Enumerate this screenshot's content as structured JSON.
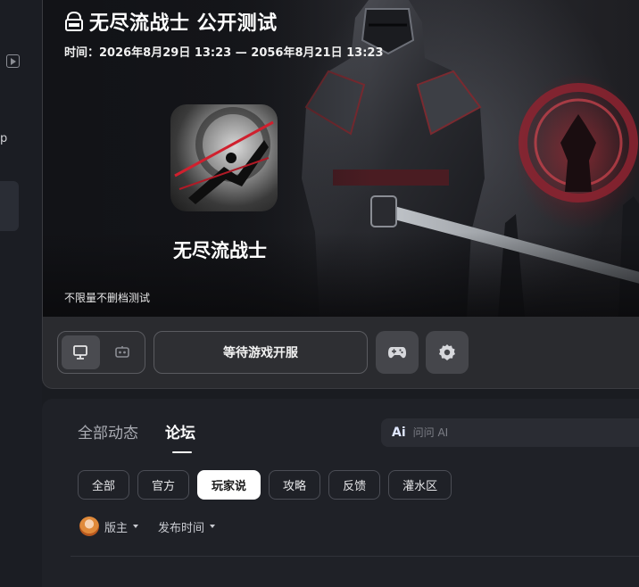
{
  "sidebar": {
    "item_text_partial": "p"
  },
  "hero": {
    "title": "无尽流战士 公开测试",
    "time": "时间：2026年8月29日 13:23 — 2056年8月21日 13:23",
    "game_name": "无尽流战士",
    "subtitle": "不限量不删档测试",
    "wait_button": "等待游戏开服",
    "platforms": [
      {
        "name": "pc",
        "icon": "monitor-icon",
        "active": true
      },
      {
        "name": "cloud",
        "icon": "cloud-gaming-icon",
        "active": false
      }
    ],
    "extra_buttons": [
      {
        "icon": "gamepad-icon"
      },
      {
        "icon": "settings-icon"
      }
    ]
  },
  "forum": {
    "tabs": [
      {
        "label": "全部动态",
        "active": false
      },
      {
        "label": "论坛",
        "active": true
      }
    ],
    "ask_ai": {
      "icon_text": "Ai",
      "placeholder": "问问 AI"
    },
    "categories": [
      {
        "label": "全部",
        "active": false
      },
      {
        "label": "官方",
        "active": false
      },
      {
        "label": "玩家说",
        "active": true
      },
      {
        "label": "攻略",
        "active": false
      },
      {
        "label": "反馈",
        "active": false
      },
      {
        "label": "灌水区",
        "active": false
      }
    ],
    "filters": {
      "moderator": "版主",
      "sort": "发布时间"
    }
  },
  "colors": {
    "background": "#1a1c21",
    "panel": "#1f2127",
    "accent_red": "#c8283a",
    "chip_active": "#ffffff"
  }
}
